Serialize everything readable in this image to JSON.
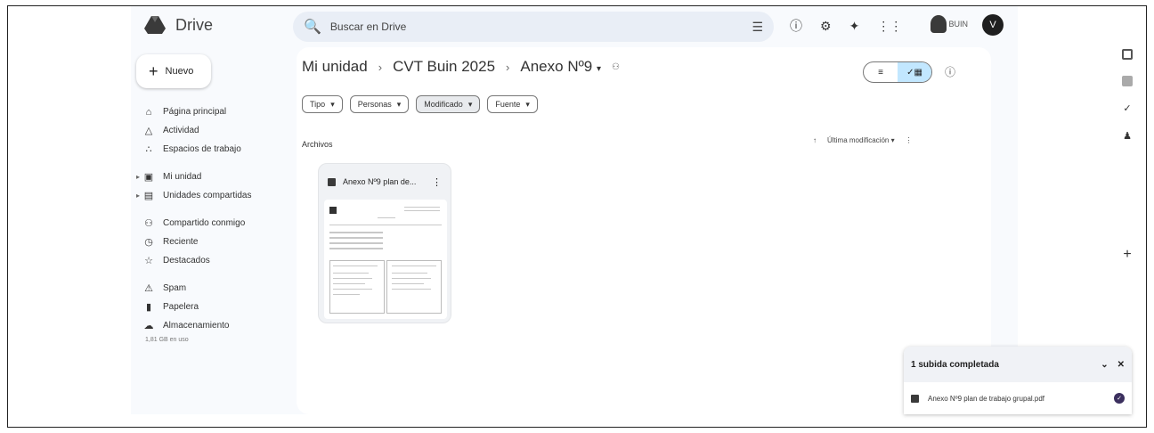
{
  "app": {
    "name": "Drive"
  },
  "search": {
    "placeholder": "Buscar en Drive"
  },
  "topbar": {
    "org_label": "BUIN",
    "avatar_initial": "V"
  },
  "new_button": {
    "label": "Nuevo"
  },
  "sidebar": {
    "items": [
      {
        "label": "Página principal",
        "icon": "home-icon"
      },
      {
        "label": "Actividad",
        "icon": "bell-icon"
      },
      {
        "label": "Espacios de trabajo",
        "icon": "workspaces-icon"
      },
      {
        "label": "Mi unidad",
        "icon": "drive-icon"
      },
      {
        "label": "Unidades compartidas",
        "icon": "shared-drives-icon"
      },
      {
        "label": "Compartido conmigo",
        "icon": "people-icon"
      },
      {
        "label": "Reciente",
        "icon": "clock-icon"
      },
      {
        "label": "Destacados",
        "icon": "star-icon"
      },
      {
        "label": "Spam",
        "icon": "spam-icon"
      },
      {
        "label": "Papelera",
        "icon": "trash-icon"
      },
      {
        "label": "Almacenamiento",
        "icon": "cloud-icon"
      }
    ],
    "storage_text": "1,81 GB en uso"
  },
  "breadcrumb": [
    "Mi unidad",
    "CVT Buin 2025",
    "Anexo Nº9"
  ],
  "filters": [
    "Tipo",
    "Personas",
    "Modificado",
    "Fuente"
  ],
  "files_section": {
    "label": "Archivos",
    "sort_label": "Última modificación"
  },
  "files": [
    {
      "name": "Anexo Nº9 plan de..."
    }
  ],
  "upload": {
    "title": "1 subida completada",
    "file": "Anexo Nº9 plan de trabajo grupal.pdf"
  }
}
